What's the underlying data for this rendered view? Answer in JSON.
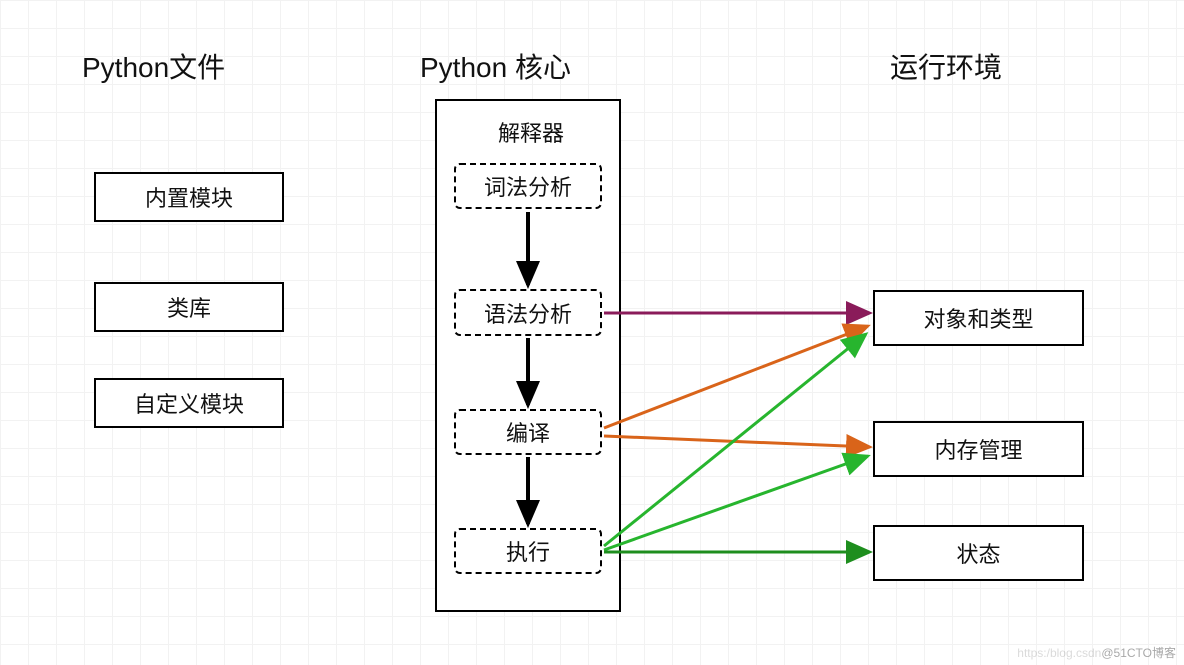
{
  "column_headings": {
    "left": "Python文件",
    "center": "Python 核心",
    "right": "运行环境"
  },
  "left_modules": {
    "builtin": "内置模块",
    "libs": "类库",
    "custom": "自定义模块"
  },
  "interpreter": {
    "container_title": "解释器",
    "steps": {
      "lex": "词法分析",
      "parse": "语法分析",
      "compile": "编译",
      "exec": "执行"
    }
  },
  "runtime": {
    "objtype": "对象和类型",
    "mem": "内存管理",
    "state": "状态"
  },
  "watermark": {
    "faint": "https:/blog.csdn",
    "text": "@51CTO博客"
  },
  "arrow_colors": {
    "black": "#000000",
    "purple": "#8a1b5a",
    "orange": "#d9641a",
    "green": "#27b52e",
    "darkgreen": "#1e8e1e"
  }
}
